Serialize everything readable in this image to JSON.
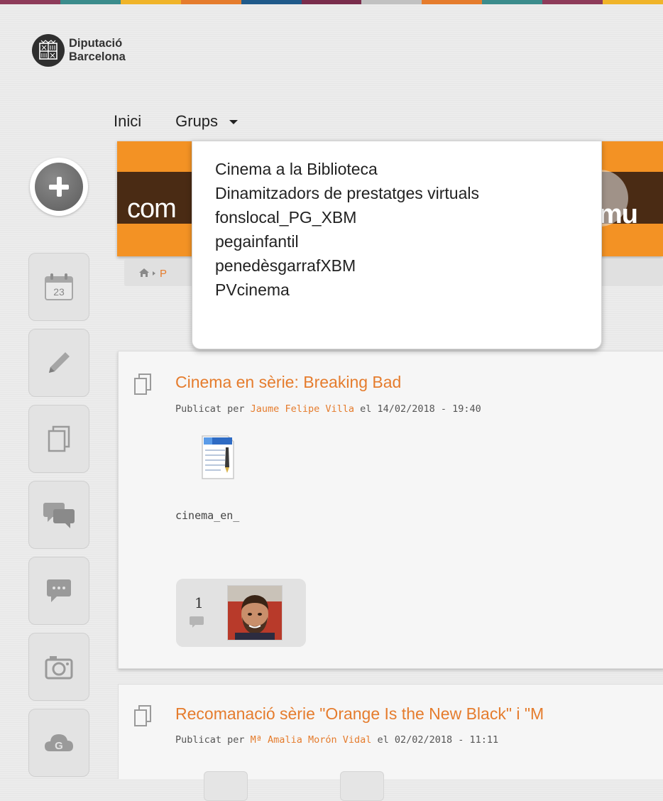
{
  "brand": {
    "org_line1": "Diputació",
    "org_line2": "Barcelona",
    "stripe_colors": [
      "#8e3b5a",
      "#3b8c8c",
      "#f0b429",
      "#e57c2d",
      "#1f5a8a",
      "#7a2d4c",
      "#c1c1c1",
      "#e57c2d",
      "#3b8c8c",
      "#8e3b5a",
      "#f0b429"
    ],
    "accent_color": "#e57c2d"
  },
  "nav": {
    "home": "Inici",
    "groups": "Grups"
  },
  "groups_menu": [
    "Cinema a la Biblioteca",
    "Dinamitzadors de prestatges virtuals",
    "fonslocal_PG_XBM",
    "pegainfantil",
    "penedèsgarrafXBM",
    "PVcinema"
  ],
  "banner": {
    "left_text": "com",
    "right_text": "mu"
  },
  "breadcrumb": {
    "current": "P"
  },
  "sidebar": {
    "calendar_day": "23",
    "icons": [
      "calendar-icon",
      "pencil-icon",
      "documents-icon",
      "chat-bubbles-icon",
      "comment-icon",
      "camera-icon",
      "google-drive-icon"
    ]
  },
  "posts": [
    {
      "title": "Cinema en sèrie: Breaking Bad",
      "meta_prefix": "Publicat per ",
      "author": "Jaume Felipe Villa",
      "meta_suffix": " el 14/02/2018 - 19:40",
      "attachment_name": "cinema_en_",
      "comment_count": "1"
    },
    {
      "title": "Recomanació sèrie \"Orange Is the New Black\" i \"M",
      "meta_prefix": "Publicat per ",
      "author": "Mª Amalia Morón Vidal",
      "meta_suffix": " el 02/02/2018 - 11:11"
    }
  ]
}
